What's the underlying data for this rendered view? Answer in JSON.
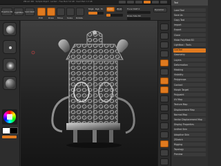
{
  "app": {
    "window_title": "ZBrush 4R2 · Sample Object · Lantern · Free Mem 5.6 GB · Used Mem 1.0 GB",
    "accent_color": "#e07a1f"
  },
  "topbar": {
    "projection_label": "Projection Master",
    "lightbox_label": "LightBox",
    "quicksketch_label": "Quick Sketch",
    "edit_label": "Edit",
    "draw_label": "Draw",
    "move_label": "Move",
    "scale_label": "Scale",
    "rotate_label": "Rotate",
    "mrgb_label": "Mrgb",
    "rgb_label": "Rgb",
    "m_label": "M",
    "zadd_label": "Zadd",
    "zsub_label": "Zsub",
    "focal_shift_label": "Focal Shift 0",
    "draw_size_label": "Draw Size 64",
    "dynamic_label": "Dynamic",
    "rgb_intensity_value": 0.6,
    "z_intensity_value": 0.25
  },
  "tray": {
    "header": "Tool",
    "items": [
      "Load Tool",
      "Save As",
      "Copy Tool",
      "Import",
      "Export",
      "Clone",
      "Make PolyMesh3D",
      "Lightbox › Tools",
      "SubTool",
      "Geometry",
      "Layers",
      "Deformation",
      "Masking",
      "Visibility",
      "Polygroups",
      "Contact",
      "Morph Target",
      "Polypaint",
      "UV Map",
      "Texture Map",
      "Displacement Map",
      "Normal Map",
      "Vector Displacement Map",
      "Display Properties",
      "Unified Skin",
      "Adaptive Skin",
      "ZSketch",
      "Rigging",
      "Topology",
      "Preview"
    ]
  },
  "leftshelf": {
    "brush_icon": "standard-brush-icon",
    "stroke_icon": "dots-stroke-icon",
    "alpha_icon": "alpha-icon",
    "material_icon": "material-ball-icon"
  },
  "canvas": {
    "model_name": "Lantern"
  }
}
